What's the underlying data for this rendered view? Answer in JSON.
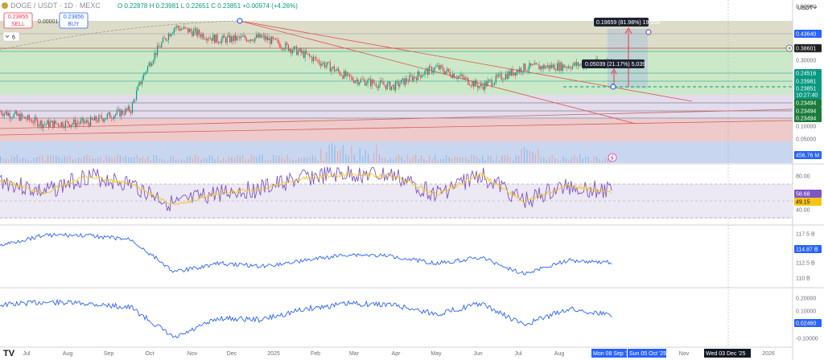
{
  "header": {
    "symbol": "DOGE / USDT · 1D · MEXC",
    "ohlc": "O 0.22878  H 0.23981  L 0.22651  C 0.23851  +0.00974 (+4.26%)",
    "sell_price": "0.23855",
    "sell_label": "SELL",
    "spread": "0.00001",
    "buy_price": "0.23856",
    "buy_label": "BUY",
    "indicator_count": "6",
    "currency": "USDT"
  },
  "colors": {
    "up": "#089981",
    "down": "#f23645",
    "rsi": "#7e57c2",
    "line": "#2962ff",
    "sell": "#f23645",
    "buy": "#2962ff",
    "projection": "#5b9bd5"
  },
  "price_axis": [
    {
      "v": "0.50000",
      "y": 8
    },
    {
      "v": "0.43640",
      "y": 42,
      "badge": true,
      "bg": "#2962ff"
    },
    {
      "v": "0.38601",
      "y": 60,
      "badge": true,
      "bg": "#1e1e1e",
      "border": true
    },
    {
      "v": "0.30000",
      "y": 75
    },
    {
      "v": "0.24516",
      "y": 91,
      "badge": true,
      "bg": "#089981"
    },
    {
      "v": "0.23981",
      "y": 101,
      "badge": true,
      "bg": "#089981"
    },
    {
      "v": "0.23851",
      "y": 110,
      "badge": true,
      "bg": "#089981"
    },
    {
      "v": "10:27:40",
      "y": 118,
      "badge": true,
      "bg": "#089981"
    },
    {
      "v": "0.23494",
      "y": 128,
      "badge": true,
      "bg": "#1b7b3a"
    },
    {
      "v": "0.23494",
      "y": 138,
      "badge": true,
      "bg": "#1b7b3a"
    },
    {
      "v": "0.23494",
      "y": 147,
      "badge": true,
      "bg": "#1b7b3a"
    },
    {
      "v": "0.10000",
      "y": 157
    },
    {
      "v": "0.05000",
      "y": 173
    },
    {
      "v": "456.76 M",
      "y": 193,
      "badge": true,
      "bg": "#2962ff"
    }
  ],
  "rsi_axis": [
    {
      "v": "80.00",
      "y": 219
    },
    {
      "v": "58.68",
      "y": 241,
      "badge": true,
      "bg": "#7e57c2"
    },
    {
      "v": "49.15",
      "y": 251,
      "badge": true,
      "bg": "#f5c518",
      "dark": true
    },
    {
      "v": "40.00",
      "y": 261
    }
  ],
  "ind1_axis": [
    {
      "v": "117.5 B",
      "y": 291
    },
    {
      "v": "114.87 B",
      "y": 310,
      "badge": true,
      "bg": "#2962ff"
    },
    {
      "v": "112.5 B",
      "y": 327
    },
    {
      "v": "110 B",
      "y": 346
    }
  ],
  "ind2_axis": [
    {
      "v": "0.20000",
      "y": 371
    },
    {
      "v": "0.10000",
      "y": 387
    },
    {
      "v": "0.02460",
      "y": 402,
      "badge": true,
      "bg": "#2962ff"
    },
    {
      "v": "-0.10000",
      "y": 421
    }
  ],
  "time_axis": [
    {
      "v": "Jul",
      "x": 33
    },
    {
      "v": "Aug",
      "x": 84
    },
    {
      "v": "Sep",
      "x": 135
    },
    {
      "v": "Oct",
      "x": 186
    },
    {
      "v": "Nov",
      "x": 239
    },
    {
      "v": "Dec",
      "x": 288
    },
    {
      "v": "2025",
      "x": 340
    },
    {
      "v": "Feb",
      "x": 392
    },
    {
      "v": "Mar",
      "x": 440
    },
    {
      "v": "Apr",
      "x": 492
    },
    {
      "v": "May",
      "x": 542
    },
    {
      "v": "Jun",
      "x": 594
    },
    {
      "v": "Jul",
      "x": 644
    },
    {
      "v": "Aug",
      "x": 695
    },
    {
      "v": "Nov",
      "x": 850
    },
    {
      "v": "2026",
      "x": 955
    }
  ],
  "time_badges": [
    {
      "v": "Mon 08 Sep '25",
      "x": 735,
      "w": 44
    },
    {
      "v": "Sun 05 Oct '25",
      "x": 780,
      "w": 48
    },
    {
      "v": "Wed 03 Dec '25",
      "x": 875,
      "w": 58
    }
  ],
  "annotations": {
    "upper_target": "0.19659 (81.98%) 19,659",
    "lower_target": "0.05039 (21.17%) 5,039"
  },
  "chart_data": [
    {
      "type": "candlestick",
      "symbol": "DOGE/USDT",
      "interval": "1D",
      "x": [
        "2024-07",
        "2024-08",
        "2024-09",
        "2024-10",
        "2024-11",
        "2024-12",
        "2025-01",
        "2025-02",
        "2025-03",
        "2025-04",
        "2025-05",
        "2025-06",
        "2025-07",
        "2025-08",
        "2025-09"
      ],
      "close": [
        0.122,
        0.103,
        0.105,
        0.125,
        0.38,
        0.32,
        0.33,
        0.26,
        0.19,
        0.17,
        0.22,
        0.17,
        0.22,
        0.225,
        0.2385
      ],
      "last": 0.23851,
      "ylim": [
        0.05,
        0.5
      ],
      "scale": "log",
      "horizontal_levels": [
        0.4364,
        0.38601,
        0.24516,
        0.23981,
        0.23494
      ]
    },
    {
      "type": "line",
      "name": "RSI",
      "levels": [
        80,
        40
      ],
      "values": [
        45,
        60,
        40,
        50,
        75,
        60,
        55,
        42,
        38,
        40,
        62,
        38,
        70,
        52,
        58.68
      ],
      "ma_last": 49.15
    },
    {
      "type": "line",
      "unit": "B",
      "values": [
        112.0,
        110.2,
        110.3,
        111.0,
        116.5,
        115.0,
        115.5,
        114.5,
        113.5,
        113.8,
        115.0,
        114.0,
        116.8,
        114.5,
        114.87
      ]
    },
    {
      "type": "line",
      "values": [
        -0.05,
        -0.07,
        -0.06,
        -0.03,
        0.2,
        0.05,
        0.06,
        -0.02,
        -0.06,
        -0.05,
        0.02,
        -0.06,
        0.1,
        -0.02,
        0.0246
      ]
    }
  ]
}
